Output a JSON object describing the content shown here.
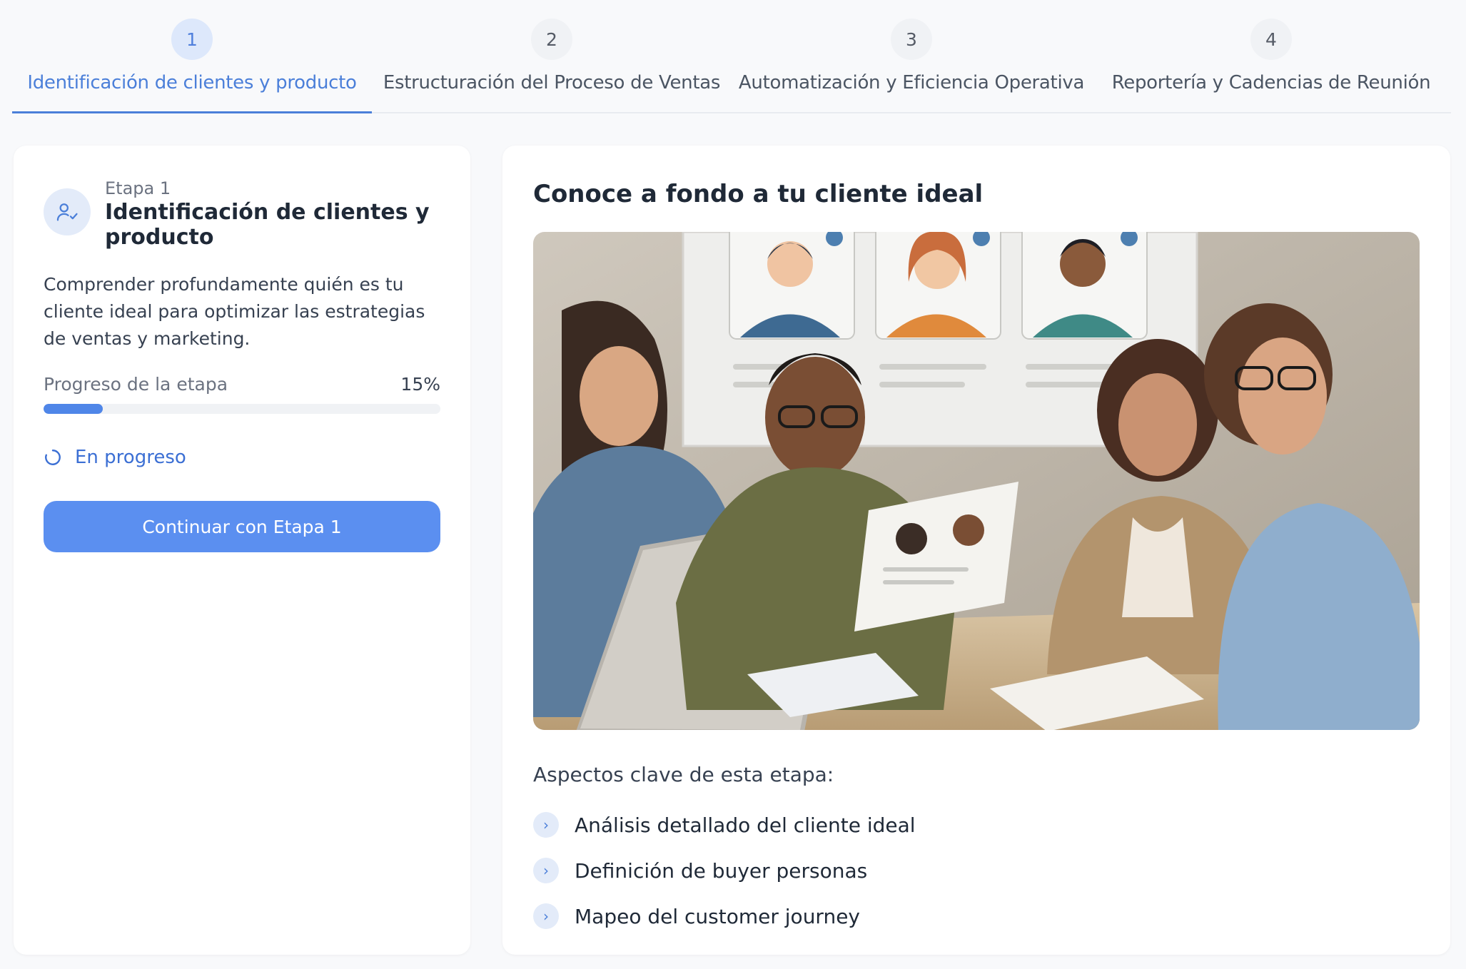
{
  "steps": [
    {
      "number": "1",
      "label": "Identificación de clientes y producto",
      "active": true
    },
    {
      "number": "2",
      "label": "Estructuración del Proceso de Ventas",
      "active": false
    },
    {
      "number": "3",
      "label": "Automatización y Eficiencia Operativa",
      "active": false
    },
    {
      "number": "4",
      "label": "Reportería y Cadencias de Reunión",
      "active": false
    }
  ],
  "stage_card": {
    "icon": "user-check-icon",
    "kicker": "Etapa 1",
    "title": "Identificación de clientes y producto",
    "description": "Comprender profundamente quién es tu cliente ideal para optimizar las estrategias de ventas y marketing.",
    "progress_label": "Progreso de la etapa",
    "progress_value": "15%",
    "progress_fraction": 0.15,
    "status_icon": "loading-spinner-icon",
    "status_label": "En progreso",
    "cta_label": "Continuar con Etapa 1"
  },
  "content": {
    "title": "Conoce a fondo a tu cliente ideal",
    "key_heading": "Aspectos clave de esta etapa:",
    "key_points": [
      "Análisis detallado del cliente ideal",
      "Definición de buyer personas",
      "Mapeo del customer journey"
    ],
    "bullet_icon": "chevron-right-icon"
  },
  "colors": {
    "accent": "#4b7fd9",
    "button": "#5b8ff0",
    "progress": "#4f86e8"
  }
}
